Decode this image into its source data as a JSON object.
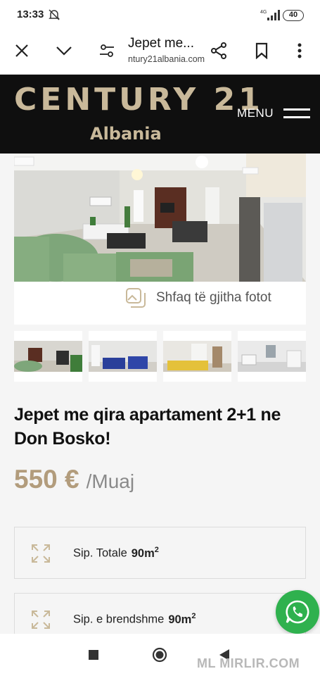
{
  "status_bar": {
    "time": "13:33",
    "network": "4G",
    "battery": "40"
  },
  "browser": {
    "page_title": "Jepet me...",
    "url": "ntury21albania.com"
  },
  "site": {
    "brand": "CENTURY 21",
    "brand_sub": "Albania",
    "menu_label": "MENU",
    "accent_color": "#c9b99a"
  },
  "gallery": {
    "show_all_label": "Shfaq të gjitha fotot",
    "thumbnail_count": 4
  },
  "listing": {
    "title": "Jepet me qira apartament 2+1 ne Don Bosko!",
    "price": "550 €",
    "period": "/Muaj",
    "price_color": "#b29c7c",
    "specs": [
      {
        "label": "Sip. Totale",
        "value": "90m",
        "sup": "2"
      },
      {
        "label": "Sip. e brendshme",
        "value": "90m",
        "sup": "2"
      }
    ]
  },
  "watermark": "MIRLIR.COM",
  "watermark_prefix": "ML"
}
